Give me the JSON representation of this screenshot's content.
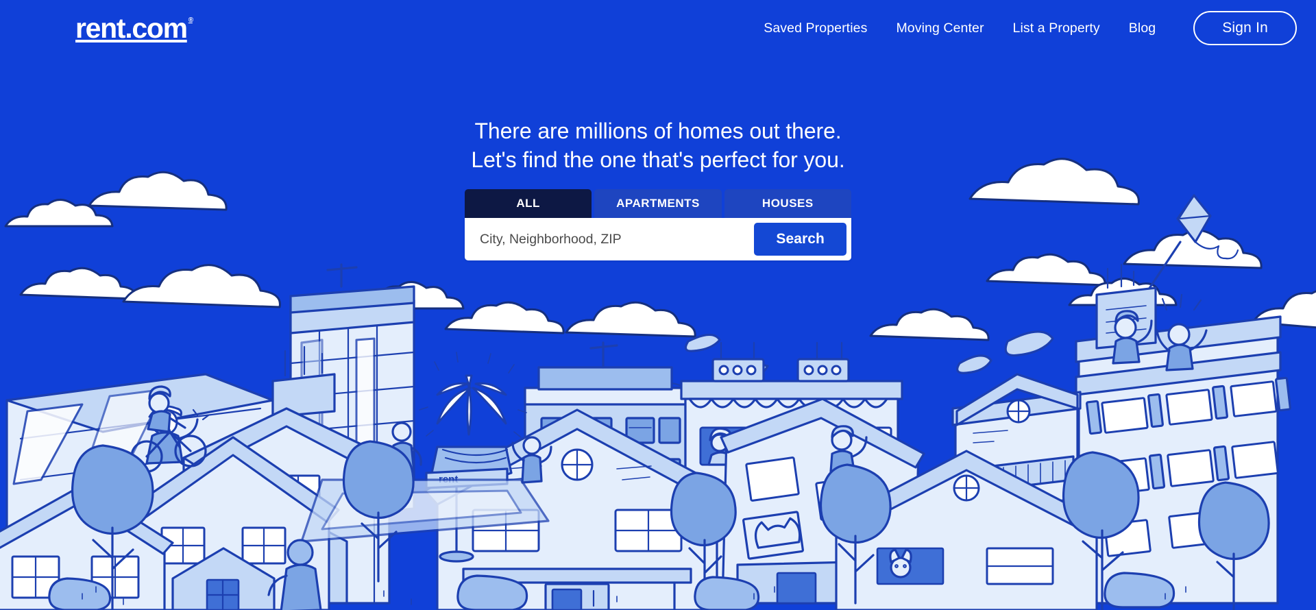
{
  "brand": {
    "logo_text": "rent.com",
    "trademark": "®",
    "background_color": "#1040d8",
    "accent_color": "#1448d4",
    "active_tab_color": "#0d1844",
    "inactive_tab_color": "#1e45c0"
  },
  "header": {
    "nav": [
      {
        "label": "Saved Properties",
        "name": "nav-saved-properties"
      },
      {
        "label": "Moving Center",
        "name": "nav-moving-center"
      },
      {
        "label": "List a Property",
        "name": "nav-list-a-property"
      },
      {
        "label": "Blog",
        "name": "nav-blog"
      }
    ],
    "sign_in_label": "Sign In"
  },
  "hero": {
    "headline_line1": "There are millions of homes out there.",
    "headline_line2": "Let's find the one that's perfect for you.",
    "tabs": [
      {
        "label": "ALL",
        "active": true
      },
      {
        "label": "APARTMENTS",
        "active": false
      },
      {
        "label": "HOUSES",
        "active": false
      }
    ],
    "search": {
      "placeholder": "City, Neighborhood, ZIP",
      "value": "",
      "button_label": "Search"
    }
  },
  "illustration": {
    "description": "Blue monochrome line-art cityscape with houses, apartment buildings, trees, clouds, people, a kite, a fountain, a bird and a street sign",
    "sky_color": "#1040d8",
    "line_color": "#1c3fb0",
    "fill_light": "#dce8fb",
    "fill_mid": "#a8c4ef",
    "fill_dark": "#7fa5e2",
    "cloud_color": "#ffffff",
    "street_sign_text": "rent"
  }
}
